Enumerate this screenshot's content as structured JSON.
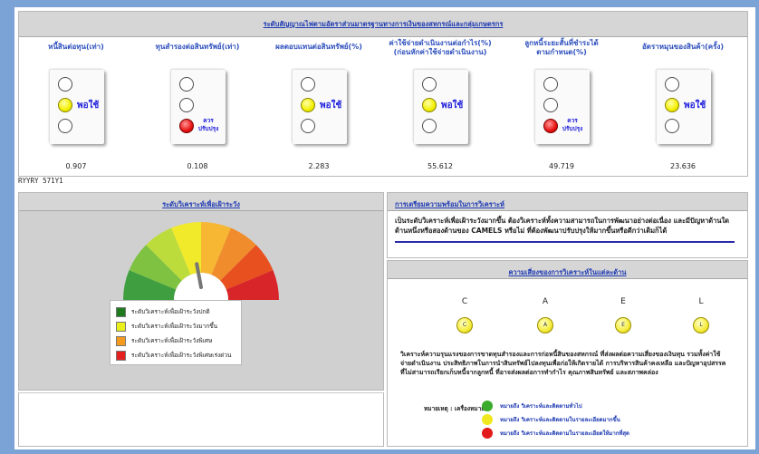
{
  "top": {
    "title": "ระดับสัญญาณไฟตามอัตราส่วนมาตรฐานทางการเงินของสหกรณ์และกลุ่มเกษตรกร",
    "indicators": [
      {
        "title": "หนี้สินต่อทุน(เท่า)",
        "lamp": "yellow",
        "status": "พอใช้",
        "value": "0.907"
      },
      {
        "title": "ทุนสำรองต่อสินทรัพย์(เท่า)",
        "lamp": "red",
        "status": "ควรปรับปรุง",
        "value": "0.108"
      },
      {
        "title": "ผลตอบแทนต่อสินทรัพย์(%)",
        "lamp": "yellow",
        "status": "พอใช้",
        "value": "2.283"
      },
      {
        "title": "ค่าใช้จ่ายดำเนินงานต่อกำไร(%)\n(ก่อนหักค่าใช้จ่ายดำเนินงาน)",
        "lamp": "yellow",
        "status": "พอใช้",
        "value": "55.612"
      },
      {
        "title": "ลูกหนี้ระยะสั้นที่ชำระได้\nตามกำหนด(%)",
        "lamp": "red",
        "status": "ควรปรับปรุง",
        "value": "49.719"
      },
      {
        "title": "อัตราหมุนของสินค้า(ครั้ง)",
        "lamp": "yellow",
        "status": "พอใช้",
        "value": "23.636"
      }
    ]
  },
  "code": "RYYRY 571Y1",
  "gauge": {
    "title": "ระดับวิเคราะห์เพื่อเฝ้าระวัง",
    "needle_level": 0.5,
    "colors": [
      "#3f9e3f",
      "#7fc241",
      "#bcdc3c",
      "#f0ea2a",
      "#f7b733",
      "#f08c2c",
      "#e8501f",
      "#d8252a"
    ],
    "legend": [
      {
        "color": "#1f7a1f",
        "label": "ระดับวิเคราะห์เพื่อเฝ้าระวังปกติ"
      },
      {
        "color": "#e8ef1a",
        "label": "ระดับวิเคราะห์เพื่อเฝ้าระวังมากขึ้น"
      },
      {
        "color": "#f59a1f",
        "label": "ระดับวิเคราะห์เพื่อเฝ้าระวังพิเศษ"
      },
      {
        "color": "#e42020",
        "label": "ระดับวิเคราะห์เพื่อเฝ้าระวังพิเศษเร่งด่วน"
      }
    ]
  },
  "recommend": {
    "title": "การเตรียมความพร้อมในการวิเคราะห์",
    "text": "เป็นระดับวิเคราะห์เพื่อเฝ้าระวังมากขึ้น ต้องวิเคราะห์ทั้งความสามารถในการพัฒนาอย่างต่อเนื่อง และมีปัญหาด้านใดด้านหนึ่งหรือสองด้านของ CAMELS หรือไม่ ที่ต้องพัฒนาปรับปรุงให้มากขึ้นหรือดีกว่าเดิมก็ได้"
  },
  "camels": {
    "title": "ความเสี่ยงของการวิเคราะห์ในแต่ละด้าน",
    "categories": [
      {
        "letter": "C",
        "circle": "C"
      },
      {
        "letter": "A",
        "circle": "A"
      },
      {
        "letter": "E",
        "circle": "E"
      },
      {
        "letter": "L",
        "circle": "L"
      }
    ],
    "text": "วิเคราะห์ความรุนแรงของการขาดทุนสำรองและการก่อหนี้สินของสหกรณ์ ที่ส่งผลต่อความเสี่ยงของเงินทุน รวมทั้งค่าใช้จ่ายดำเนินงาน ประสิทธิภาพในการนำสินทรัพย์ไปลงทุนเพื่อก่อให้เกิดรายได้ การบริหารสินค้าคงเหลือ และปัญหาอุปสรรคที่ไม่สามารถเรียกเก็บหนี้จากลูกหนี้ ที่อาจส่งผลต่อการทำกำไร คุณภาพสินทรัพย์ และสภาพคล่อง",
    "note_label": "หมายเหตุ : เครื่องหมาย",
    "notes": [
      {
        "color": "#3aab2a",
        "label": "หมายถึง วิเคราะห์และติดตามทั่วไป"
      },
      {
        "color": "#efe81e",
        "label": "หมายถึง วิเคราะห์และติดตามในรายละเอียดมากขึ้น"
      },
      {
        "color": "#e21a1a",
        "label": "หมายถึง วิเคราะห์และติดตามในรายละเอียดให้มากที่สุด"
      }
    ]
  }
}
